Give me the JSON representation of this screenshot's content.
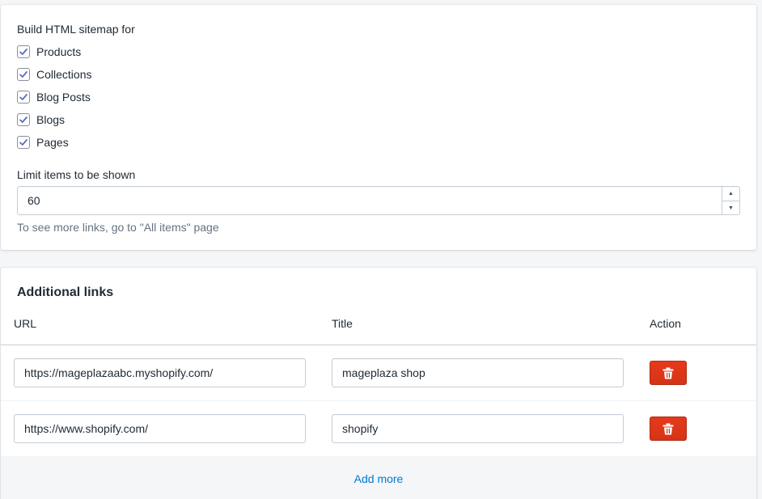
{
  "sitemap": {
    "heading": "Build HTML sitemap for",
    "options": [
      {
        "label": "Products",
        "checked": true
      },
      {
        "label": "Collections",
        "checked": true
      },
      {
        "label": "Blog Posts",
        "checked": true
      },
      {
        "label": "Blogs",
        "checked": true
      },
      {
        "label": "Pages",
        "checked": true
      }
    ],
    "limit_label": "Limit items to be shown",
    "limit_value": "60",
    "help_text": "To see more links, go to \"All items\" page"
  },
  "links": {
    "title": "Additional links",
    "columns": {
      "url": "URL",
      "title": "Title",
      "action": "Action"
    },
    "rows": [
      {
        "url": "https://mageplazaabc.myshopify.com/",
        "title": "mageplaza shop"
      },
      {
        "url": "https://www.shopify.com/",
        "title": "shopify"
      }
    ],
    "add_more": "Add more"
  },
  "colors": {
    "accent": "#007ace",
    "danger": "#de3618",
    "check": "#5c6ac4"
  }
}
